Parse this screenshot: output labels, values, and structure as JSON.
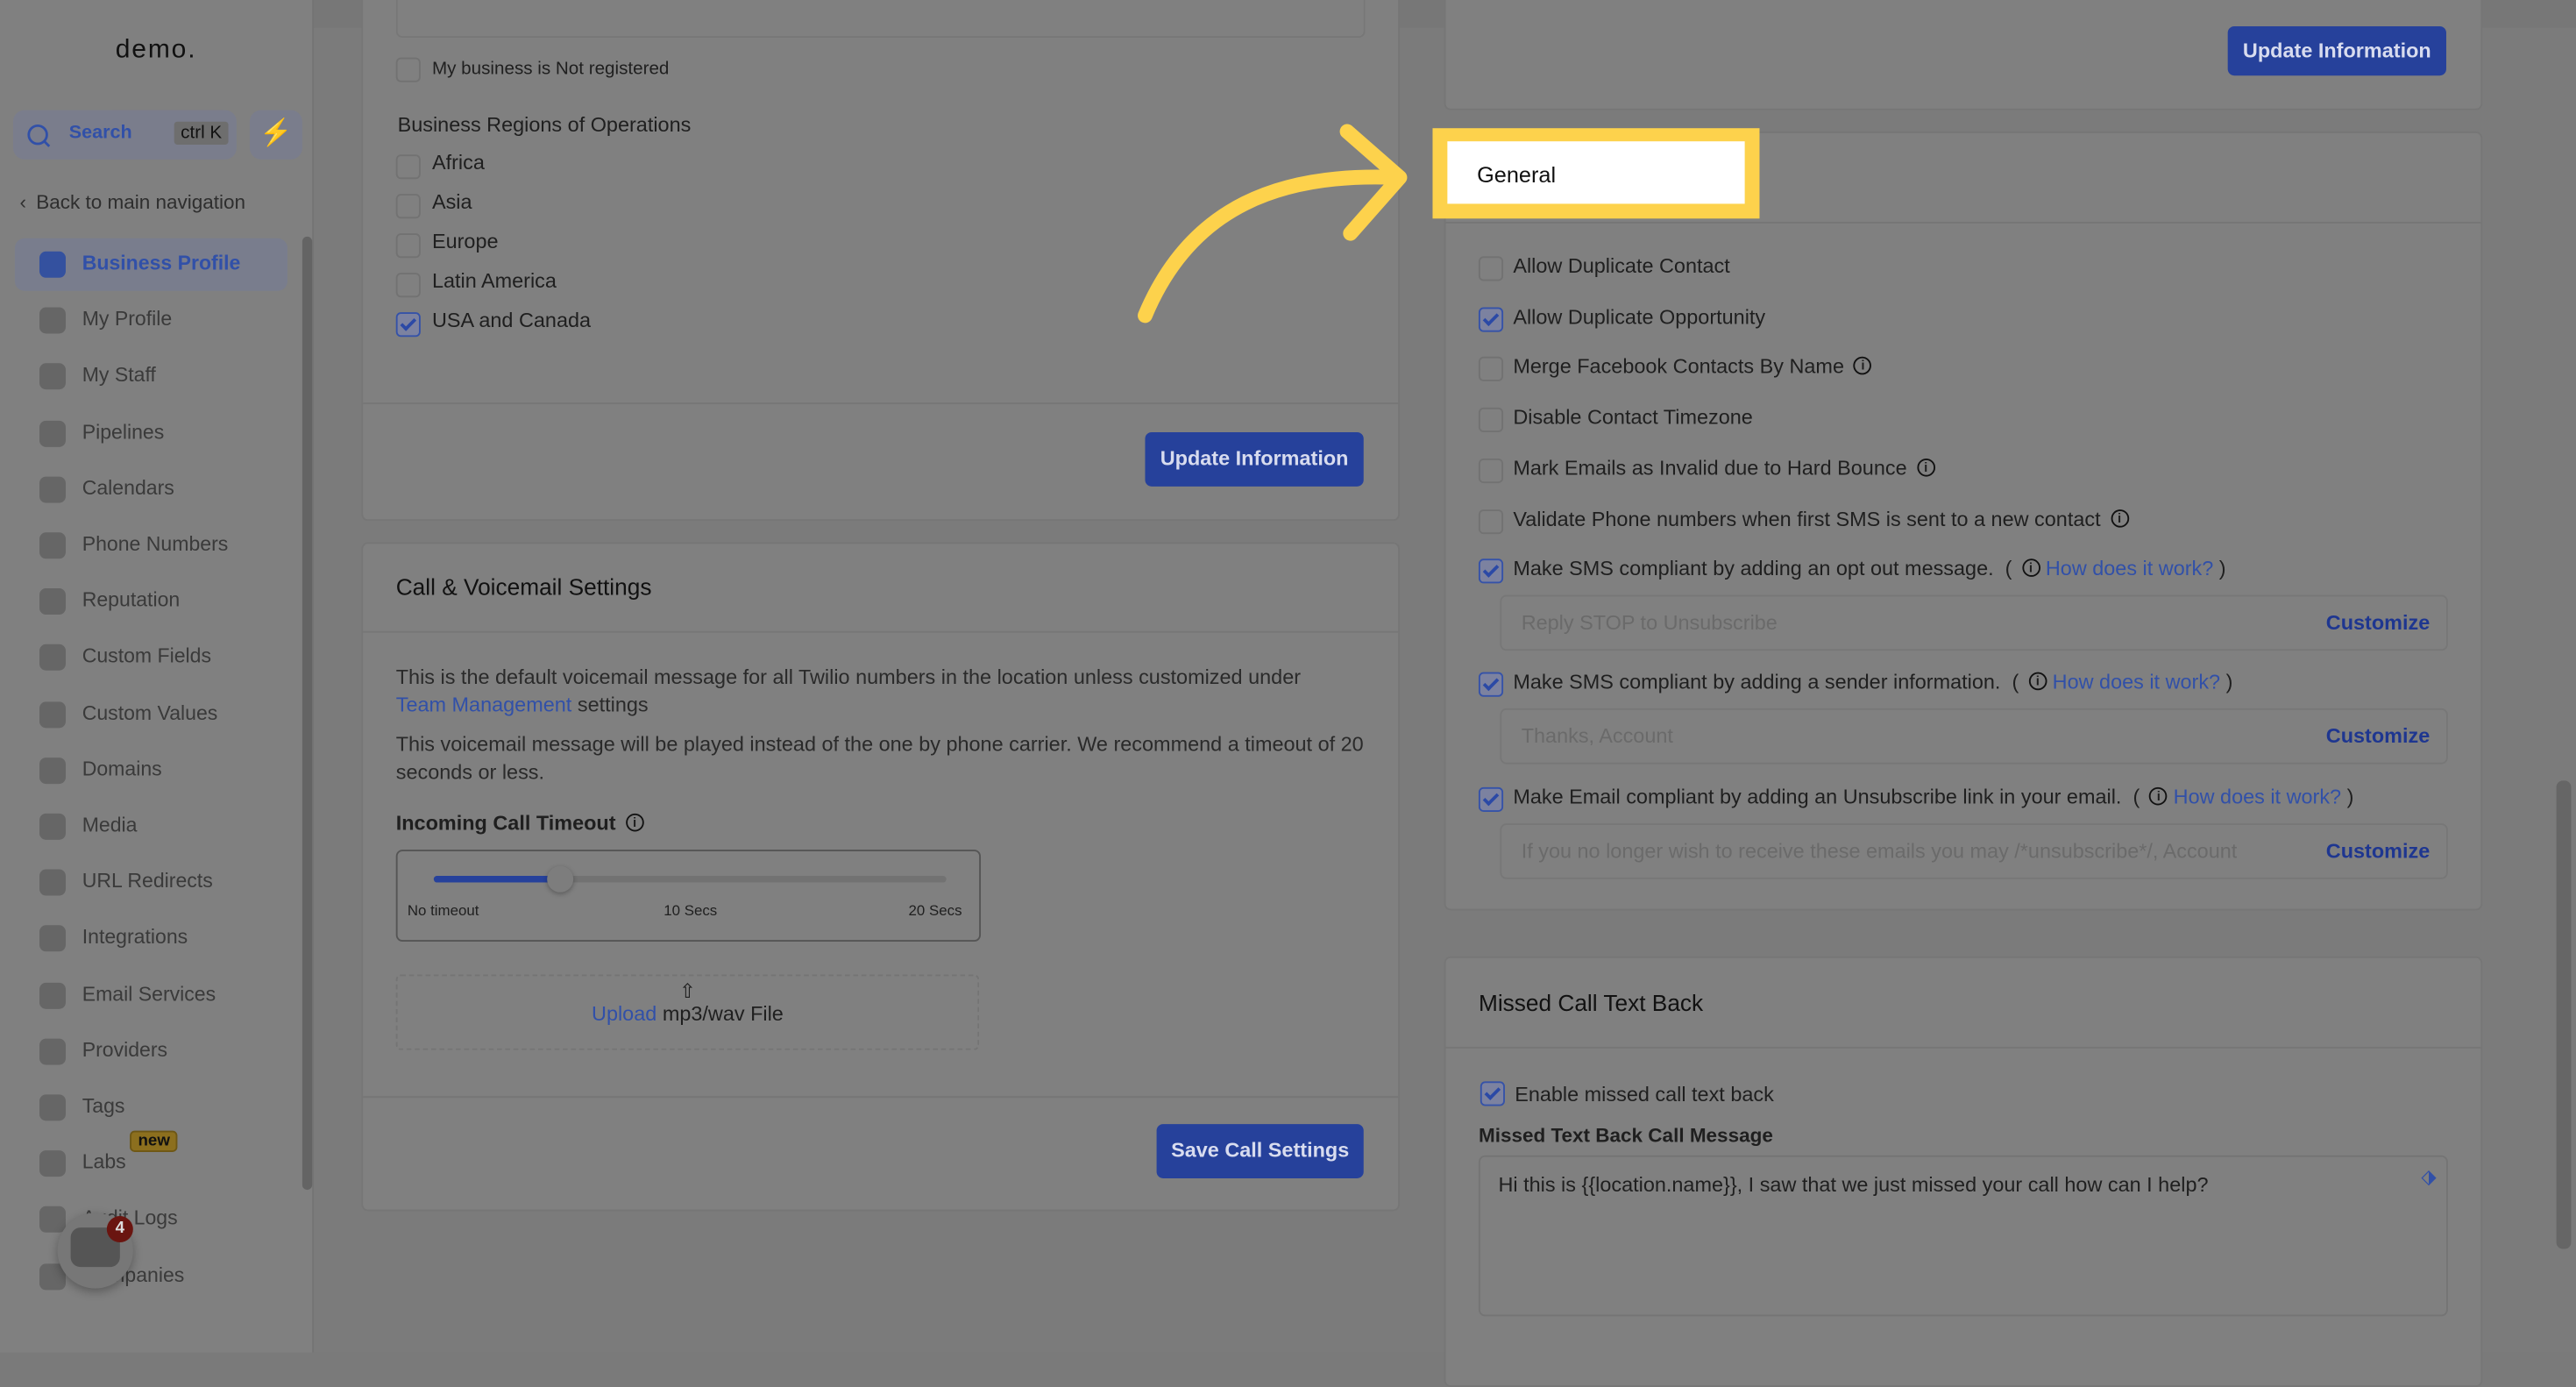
{
  "sidebar": {
    "logo": "demo.",
    "search_label": "Search",
    "search_shortcut": "ctrl K",
    "back_label": "Back to main navigation",
    "items": [
      {
        "label": "Business Profile",
        "icon": "briefcase-icon",
        "active": true
      },
      {
        "label": "My Profile",
        "icon": "user-circle-icon"
      },
      {
        "label": "My Staff",
        "icon": "user-icon"
      },
      {
        "label": "Pipelines",
        "icon": "filter-icon"
      },
      {
        "label": "Calendars",
        "icon": "calendar-icon"
      },
      {
        "label": "Phone Numbers",
        "icon": "phone-icon"
      },
      {
        "label": "Reputation",
        "icon": "star-icon"
      },
      {
        "label": "Custom Fields",
        "icon": "fields-icon"
      },
      {
        "label": "Custom Values",
        "icon": "values-icon"
      },
      {
        "label": "Domains",
        "icon": "globe-icon"
      },
      {
        "label": "Media",
        "icon": "media-icon"
      },
      {
        "label": "URL Redirects",
        "icon": "redirect-icon"
      },
      {
        "label": "Integrations",
        "icon": "integrations-icon"
      },
      {
        "label": "Email Services",
        "icon": "email-icon"
      },
      {
        "label": "Providers",
        "icon": "clipboard-icon"
      },
      {
        "label": "Tags",
        "icon": "tag-icon"
      },
      {
        "label": "Labs",
        "icon": "flask-icon",
        "badge": "new"
      },
      {
        "label": "Audit Logs",
        "icon": "bar-chart-icon"
      },
      {
        "label": "Companies",
        "icon": "building-icon"
      }
    ],
    "chat_badge_count": "4"
  },
  "left": {
    "not_registered": "My business is Not registered",
    "regions_title": "Business Regions of Operations",
    "regions": [
      {
        "label": "Africa",
        "checked": false
      },
      {
        "label": "Asia",
        "checked": false
      },
      {
        "label": "Europe",
        "checked": false
      },
      {
        "label": "Latin America",
        "checked": false
      },
      {
        "label": "USA and Canada",
        "checked": true
      }
    ],
    "update_button": "Update Information",
    "call": {
      "title": "Call & Voicemail Settings",
      "desc1": "This is the default voicemail message for all Twilio numbers in the location unless customized under",
      "desc1_link": "Team Management",
      "desc1_end": "settings",
      "desc2": "This voicemail message will be played instead of the one by phone carrier. We recommend a timeout of 20 seconds or less.",
      "timeout_label": "Incoming Call Timeout",
      "timeout_value_secs": 3,
      "timeout_range_secs": [
        0,
        20
      ],
      "ticks": [
        "No timeout",
        "10 Secs",
        "20 Secs"
      ],
      "upload_link": "Upload",
      "upload_text": "mp3/wav File",
      "save_button": "Save Call Settings"
    }
  },
  "right": {
    "top_update_button": "Update Information",
    "general_title": "General",
    "options": [
      {
        "label": "Allow Duplicate Contact",
        "checked": false
      },
      {
        "label": "Allow Duplicate Opportunity",
        "checked": true
      },
      {
        "label": "Merge Facebook Contacts By Name",
        "checked": false,
        "info": true
      },
      {
        "label": "Disable Contact Timezone",
        "checked": false
      },
      {
        "label": "Mark Emails as Invalid due to Hard Bounce",
        "checked": false,
        "info": true
      },
      {
        "label": "Validate Phone numbers when first SMS is sent to a new contact",
        "checked": false,
        "info": true
      }
    ],
    "compliance": [
      {
        "label": "Make SMS compliant by adding an opt out message.",
        "link": "How does it work?",
        "placeholder": "Reply STOP to Unsubscribe",
        "customize": "Customize",
        "checked": true
      },
      {
        "label": "Make SMS compliant by adding a sender information.",
        "link": "How does it work?",
        "placeholder": "Thanks, Account",
        "customize": "Customize",
        "checked": true
      },
      {
        "label": "Make Email compliant by adding an Unsubscribe link in your email.",
        "link": "How does it work?",
        "placeholder": "If you no longer wish to receive these emails you may /*unsubscribe*/, Account",
        "customize": "Customize",
        "checked": true
      }
    ],
    "missed": {
      "title": "Missed Call Text Back",
      "enable_label": "Enable missed call text back",
      "enabled": true,
      "message_label": "Missed Text Back Call Message",
      "message": "Hi this is {{location.name}}, I saw that we just missed your call how can I help?"
    }
  },
  "colors": {
    "highlight": "#fdd24c",
    "accent": "#26419b"
  }
}
